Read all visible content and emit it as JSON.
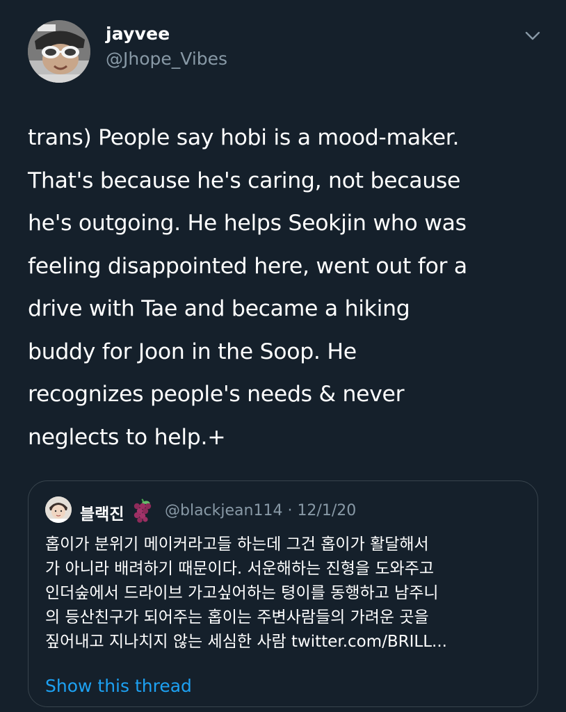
{
  "tweet": {
    "display_name": "jayvee",
    "handle": "@Jhope_Vibes",
    "text_lines": [
      "trans) People say hobi is a mood-maker.",
      "That's because he's caring, not because",
      "he's outgoing. He helps Seokjin who was",
      "feeling disappointed here, went out for a",
      "drive with Tae and became a hiking",
      "buddy for Joon in the Soop. He",
      "recognizes people's needs & never",
      "neglects to help.+"
    ]
  },
  "quote": {
    "display_name": "블랙진",
    "emoji": "grapes-emoji",
    "meta": "@blackjean114 · 12/1/20",
    "text_lines": [
      "홉이가 분위기 메이커라고들 하는데 그건 홉이가 활달해서",
      "가 아니라 배려하기 때문이다. 서운해하는 진형을 도와주고",
      "인더숲에서 드라이브 가고싶어하는 텽이를 동행하고 남주니",
      "의 등산친구가 되어주는 홉이는 주변사람들의 가려운 곳을",
      "짚어내고 지나치지 않는 세심한 사람 twitter.com/BRILL..."
    ],
    "show_thread": "Show this thread"
  },
  "colors": {
    "background": "#15202b",
    "secondary_text": "#8899a6",
    "link": "#1da1f2",
    "border": "#38444d"
  }
}
